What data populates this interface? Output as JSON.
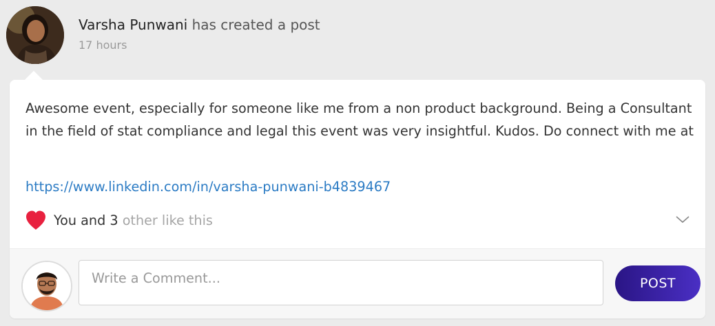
{
  "post": {
    "author_name": "Varsha Punwani",
    "action_text": "has created a post",
    "timestamp": "17 hours",
    "body": "Awesome event, especially for someone like me from a non product background. Being a Consultant in the field of stat compliance and legal this event was very insightful. Kudos. Do connect with me at",
    "link": "https://www.linkedin.com/in/varsha-punwani-b4839467",
    "likes": {
      "prefix": "You and 3",
      "suffix": "other like this",
      "heart_color": "#e8213f"
    }
  },
  "comment": {
    "placeholder": "Write a Comment...",
    "value": "",
    "post_button_label": "POST",
    "button_color": "#33199e"
  },
  "icons": {
    "like": "heart-icon",
    "expand": "chevron-down-icon"
  }
}
